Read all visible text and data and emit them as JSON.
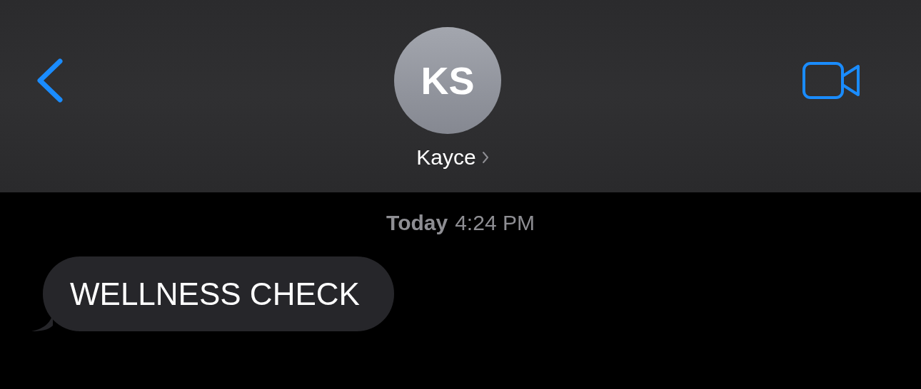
{
  "header": {
    "avatar_initials": "KS",
    "name": "Kayce"
  },
  "timestamp": {
    "day": "Today",
    "time": "4:24 PM"
  },
  "messages": [
    {
      "kind": "incoming",
      "text": "WELLNESS CHECK"
    }
  ]
}
